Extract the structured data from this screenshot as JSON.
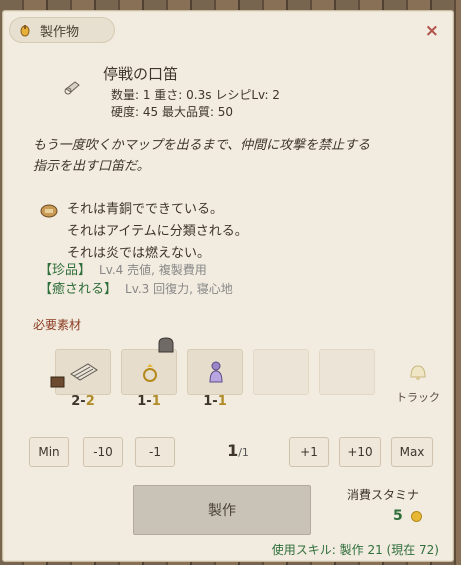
{
  "window": {
    "title": "製作物",
    "close_label": "×"
  },
  "item": {
    "name": "停戦の口笛",
    "stats_line1": "数量: 1  重さ: 0.3s  レシピLv: 2",
    "stats_line2": "硬度: 45  最大品質: 50",
    "description_1": "もう一度吹くかマップを出るまで、仲間に攻撃を禁止する",
    "description_2": "指示を出す口笛だ。",
    "properties": [
      "それは青銅でできている。",
      "それはアイテムに分類される。",
      "それは炎では燃えない。"
    ],
    "traits": [
      {
        "name": "【珍品】",
        "desc": "Lv.4 売値, 複製費用"
      },
      {
        "name": "【癒される】",
        "desc": "Lv.3 回復力, 寝心地"
      }
    ]
  },
  "materials": {
    "label": "必要素材",
    "slots": [
      {
        "icon": "scroll-icon",
        "have": "2",
        "need": "2"
      },
      {
        "icon": "ring-icon",
        "have": "1",
        "need": "1"
      },
      {
        "icon": "figurine-icon",
        "have": "1",
        "need": "1"
      }
    ],
    "track_label": "トラック"
  },
  "quantity": {
    "min_label": "Min",
    "minus10_label": "-10",
    "minus1_label": "-1",
    "current": "1",
    "total": "/1",
    "plus1_label": "+1",
    "plus10_label": "+10",
    "max_label": "Max"
  },
  "craft": {
    "button_label": "製作",
    "stamina_label": "消費スタミナ",
    "stamina_value": "5",
    "skill_text": "使用スキル: 製作 21 (現在 72)"
  },
  "colors": {
    "panel_bg": "#f2ece0",
    "trait_green": "#2f6e3a",
    "close_red": "#b2524a",
    "need_gold": "#b08a25"
  }
}
